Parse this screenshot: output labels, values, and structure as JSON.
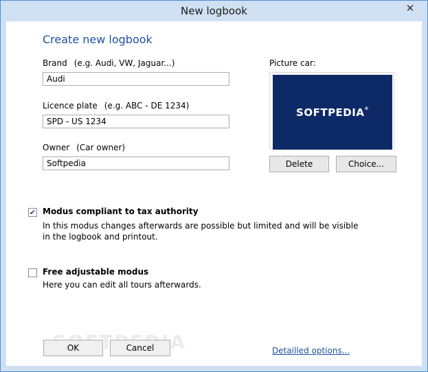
{
  "window": {
    "title": "New logbook",
    "close_icon": "close-icon"
  },
  "form": {
    "heading": "Create new logbook",
    "brand": {
      "label": "Brand",
      "hint": "(e.g. Audi, VW, Jaguar...)",
      "value": "Audi"
    },
    "plate": {
      "label": "Licence plate",
      "hint": "(e.g. ABC - DE 1234)",
      "value": "SPD - US 1234"
    },
    "owner": {
      "label": "Owner",
      "hint": "(Car owner)",
      "value": "Softpedia"
    }
  },
  "picture": {
    "label": "Picture car:",
    "image_text": "SOFTPEDIA",
    "image_mark": "®",
    "delete_label": "Delete",
    "choice_label": "Choice..."
  },
  "modes": {
    "tax": {
      "checked": true,
      "title": "Modus compliant to tax authority",
      "description": "In this modus changes afterwards are possible but limited and will be visible in the logbook and printout."
    },
    "free": {
      "checked": false,
      "title": "Free adjustable modus",
      "description": "Here you can edit all tours afterwards."
    }
  },
  "footer": {
    "ok_label": "OK",
    "cancel_label": "Cancel",
    "details_link": "Detailled options...",
    "watermark": "SOFTPEDIA"
  },
  "colors": {
    "accent": "#1e50a2",
    "title_bar": "#cfe0f3",
    "image_bg": "#0e2a66"
  }
}
